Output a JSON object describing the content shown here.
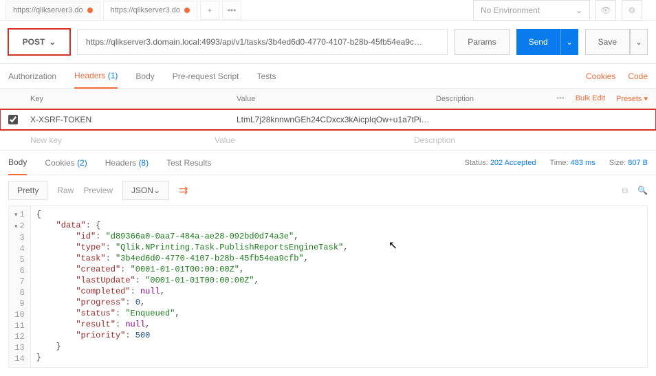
{
  "tabs": {
    "t1": "https://qlikserver3.do",
    "t2": "https://qlikserver3.do"
  },
  "env": {
    "label": "No Environment"
  },
  "request": {
    "method": "POST",
    "url": "https://qlikserver3.domain.local:4993/api/v1/tasks/3b4ed6d0-4770-4107-b28b-45fb54ea9c…",
    "params": "Params",
    "send": "Send",
    "save": "Save"
  },
  "reqtabs": {
    "auth": "Authorization",
    "headers": "Headers",
    "headers_count": "(1)",
    "body": "Body",
    "prereq": "Pre-request Script",
    "tests": "Tests",
    "cookies_link": "Cookies",
    "code_link": "Code"
  },
  "headers_table": {
    "col_key": "Key",
    "col_value": "Value",
    "col_desc": "Description",
    "bulk": "Bulk Edit",
    "presets": "Presets ▾",
    "row_key": "X-XSRF-TOKEN",
    "row_val": "LtmL7j28knnwnGEh24CDxcx3kAicpIqOw+u1a7tPi…",
    "ph_key": "New key",
    "ph_val": "Value",
    "ph_desc": "Description"
  },
  "resp_tabs": {
    "body": "Body",
    "cookies": "Cookies",
    "cookies_count": "(2)",
    "headers": "Headers",
    "headers_count": "(8)",
    "tests": "Test Results",
    "status_label": "Status:",
    "status_val": "202 Accepted",
    "time_label": "Time:",
    "time_val": "483 ms",
    "size_label": "Size:",
    "size_val": "807 B"
  },
  "toolbar": {
    "pretty": "Pretty",
    "raw": "Raw",
    "preview": "Preview",
    "format": "JSON"
  },
  "chart_data": {
    "data": {
      "id": "d89366a0-0aa7-484a-ae28-092bd0d74a3e",
      "type": "Qlik.NPrinting.Task.PublishReportsEngineTask",
      "task": "3b4ed6d0-4770-4107-b28b-45fb54ea9cfb",
      "created": "0001-01-01T00:00:00Z",
      "lastUpdate": "0001-01-01T00:00:00Z",
      "completed": null,
      "progress": 0,
      "status": "Enqueued",
      "result": null,
      "priority": 500
    }
  }
}
